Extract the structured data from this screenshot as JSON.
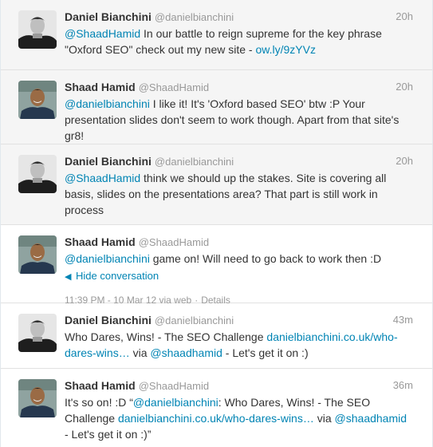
{
  "tweets": [
    {
      "name": "Daniel Bianchini",
      "handle": "@danielbianchini",
      "time": "20h",
      "mention": "@ShaadHamid",
      "text1": " In our battle to reign supreme for the key phrase \"Oxford SEO\" check out my new site - ",
      "link": "ow.ly/9zYVz"
    },
    {
      "name": "Shaad Hamid",
      "handle": "@ShaadHamid",
      "time": "20h",
      "mention": "@danielbianchini",
      "text1": " I like it! It's 'Oxford based SEO' btw :P Your presentation slides don't seem to work though. Apart from that site's gr8!"
    },
    {
      "name": "Daniel Bianchini",
      "handle": "@danielbianchini",
      "time": "20h",
      "mention": "@ShaadHamid",
      "text1": " think we should up the stakes. Site is covering all basis, slides on the presentations area? That part is still work in process"
    },
    {
      "name": "Shaad Hamid",
      "handle": "@ShaadHamid",
      "mention": "@danielbianchini",
      "text1": " game on! Will need to go back to work then :D",
      "hide_conversation": "Hide conversation",
      "timestamp": "11:39 PM - 10 Mar 12 via web",
      "separator": "·",
      "details": "Details"
    },
    {
      "name": "Daniel Bianchini",
      "handle": "@danielbianchini",
      "time": "43m",
      "text1": "Who Dares, Wins! - The SEO Challenge ",
      "link": "danielbianchini.co.uk/who-dares-wins…",
      "text2": " via ",
      "mention2": "@shaadhamid",
      "text3": " - Let's get it on :)"
    },
    {
      "name": "Shaad Hamid",
      "handle": "@ShaadHamid",
      "time": "36m",
      "text1": "It's so on! :D “",
      "mention": "@danielbianchini",
      "text2": ": Who Dares, Wins! - The SEO Challenge ",
      "link": "danielbianchini.co.uk/who-dares-wins…",
      "text3": " via ",
      "mention2": "@shaadhamid",
      "text4": " - Let's get it on :)”"
    }
  ],
  "colors": {
    "link": "#0084b4",
    "muted": "#999999",
    "grey_bg": "#f5f5f5",
    "text": "#333333"
  }
}
